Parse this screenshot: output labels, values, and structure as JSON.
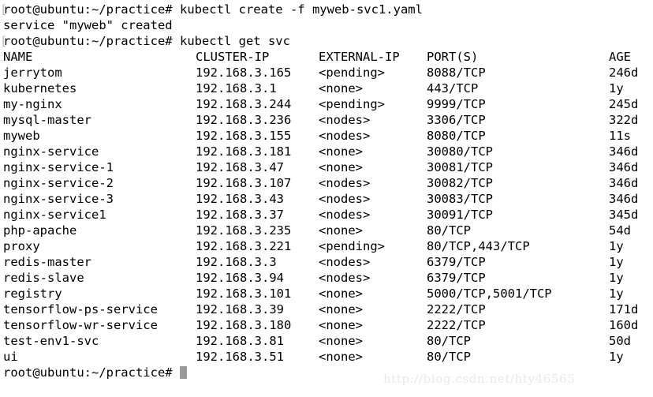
{
  "terminal": {
    "prompt": "root@ubuntu:~/practice#",
    "edge_artifact": "[",
    "command_1": "kubectl create -f myweb-svc1.yaml",
    "output_1": "service \"myweb\" created",
    "command_2": "kubectl get svc",
    "cursor": "block-cursor",
    "colors": {
      "background": "#ffffff",
      "text": "#000000",
      "cursor": "#9a9a9a",
      "watermark": "#e8e8e8"
    }
  },
  "table": {
    "headers": {
      "name": "NAME",
      "cluster_ip": "CLUSTER-IP",
      "external_ip": "EXTERNAL-IP",
      "ports": "PORT(S)",
      "age": "AGE"
    },
    "rows": [
      {
        "name": "jerrytom",
        "cluster_ip": "192.168.3.165",
        "external_ip": "<pending>",
        "ports": "8088/TCP",
        "age": "246d"
      },
      {
        "name": "kubernetes",
        "cluster_ip": "192.168.3.1",
        "external_ip": "<none>",
        "ports": "443/TCP",
        "age": "1y"
      },
      {
        "name": "my-nginx",
        "cluster_ip": "192.168.3.244",
        "external_ip": "<pending>",
        "ports": "9999/TCP",
        "age": "245d"
      },
      {
        "name": "mysql-master",
        "cluster_ip": "192.168.3.236",
        "external_ip": "<nodes>",
        "ports": "3306/TCP",
        "age": "322d"
      },
      {
        "name": "myweb",
        "cluster_ip": "192.168.3.155",
        "external_ip": "<nodes>",
        "ports": "8080/TCP",
        "age": "11s"
      },
      {
        "name": "nginx-service",
        "cluster_ip": "192.168.3.181",
        "external_ip": "<none>",
        "ports": "30080/TCP",
        "age": "346d"
      },
      {
        "name": "nginx-service-1",
        "cluster_ip": "192.168.3.47",
        "external_ip": "<none>",
        "ports": "30081/TCP",
        "age": "346d"
      },
      {
        "name": "nginx-service-2",
        "cluster_ip": "192.168.3.107",
        "external_ip": "<nodes>",
        "ports": "30082/TCP",
        "age": "346d"
      },
      {
        "name": "nginx-service-3",
        "cluster_ip": "192.168.3.43",
        "external_ip": "<nodes>",
        "ports": "30083/TCP",
        "age": "346d"
      },
      {
        "name": "nginx-service1",
        "cluster_ip": "192.168.3.37",
        "external_ip": "<nodes>",
        "ports": "30091/TCP",
        "age": "345d"
      },
      {
        "name": "php-apache",
        "cluster_ip": "192.168.3.235",
        "external_ip": "<none>",
        "ports": "80/TCP",
        "age": "54d"
      },
      {
        "name": "proxy",
        "cluster_ip": "192.168.3.221",
        "external_ip": "<pending>",
        "ports": "80/TCP,443/TCP",
        "age": "1y"
      },
      {
        "name": "redis-master",
        "cluster_ip": "192.168.3.3",
        "external_ip": "<nodes>",
        "ports": "6379/TCP",
        "age": "1y"
      },
      {
        "name": "redis-slave",
        "cluster_ip": "192.168.3.94",
        "external_ip": "<nodes>",
        "ports": "6379/TCP",
        "age": "1y"
      },
      {
        "name": "registry",
        "cluster_ip": "192.168.3.101",
        "external_ip": "<none>",
        "ports": "5000/TCP,5001/TCP",
        "age": "1y"
      },
      {
        "name": "tensorflow-ps-service",
        "cluster_ip": "192.168.3.39",
        "external_ip": "<none>",
        "ports": "2222/TCP",
        "age": "171d"
      },
      {
        "name": "tensorflow-wr-service",
        "cluster_ip": "192.168.3.180",
        "external_ip": "<none>",
        "ports": "2222/TCP",
        "age": "160d"
      },
      {
        "name": "test-env1-svc",
        "cluster_ip": "192.168.3.81",
        "external_ip": "<none>",
        "ports": "80/TCP",
        "age": "50d"
      },
      {
        "name": "ui",
        "cluster_ip": "192.168.3.51",
        "external_ip": "<none>",
        "ports": "80/TCP",
        "age": "1y"
      }
    ]
  },
  "watermark": {
    "text": "http://blog.csdn.net/hty46565"
  }
}
